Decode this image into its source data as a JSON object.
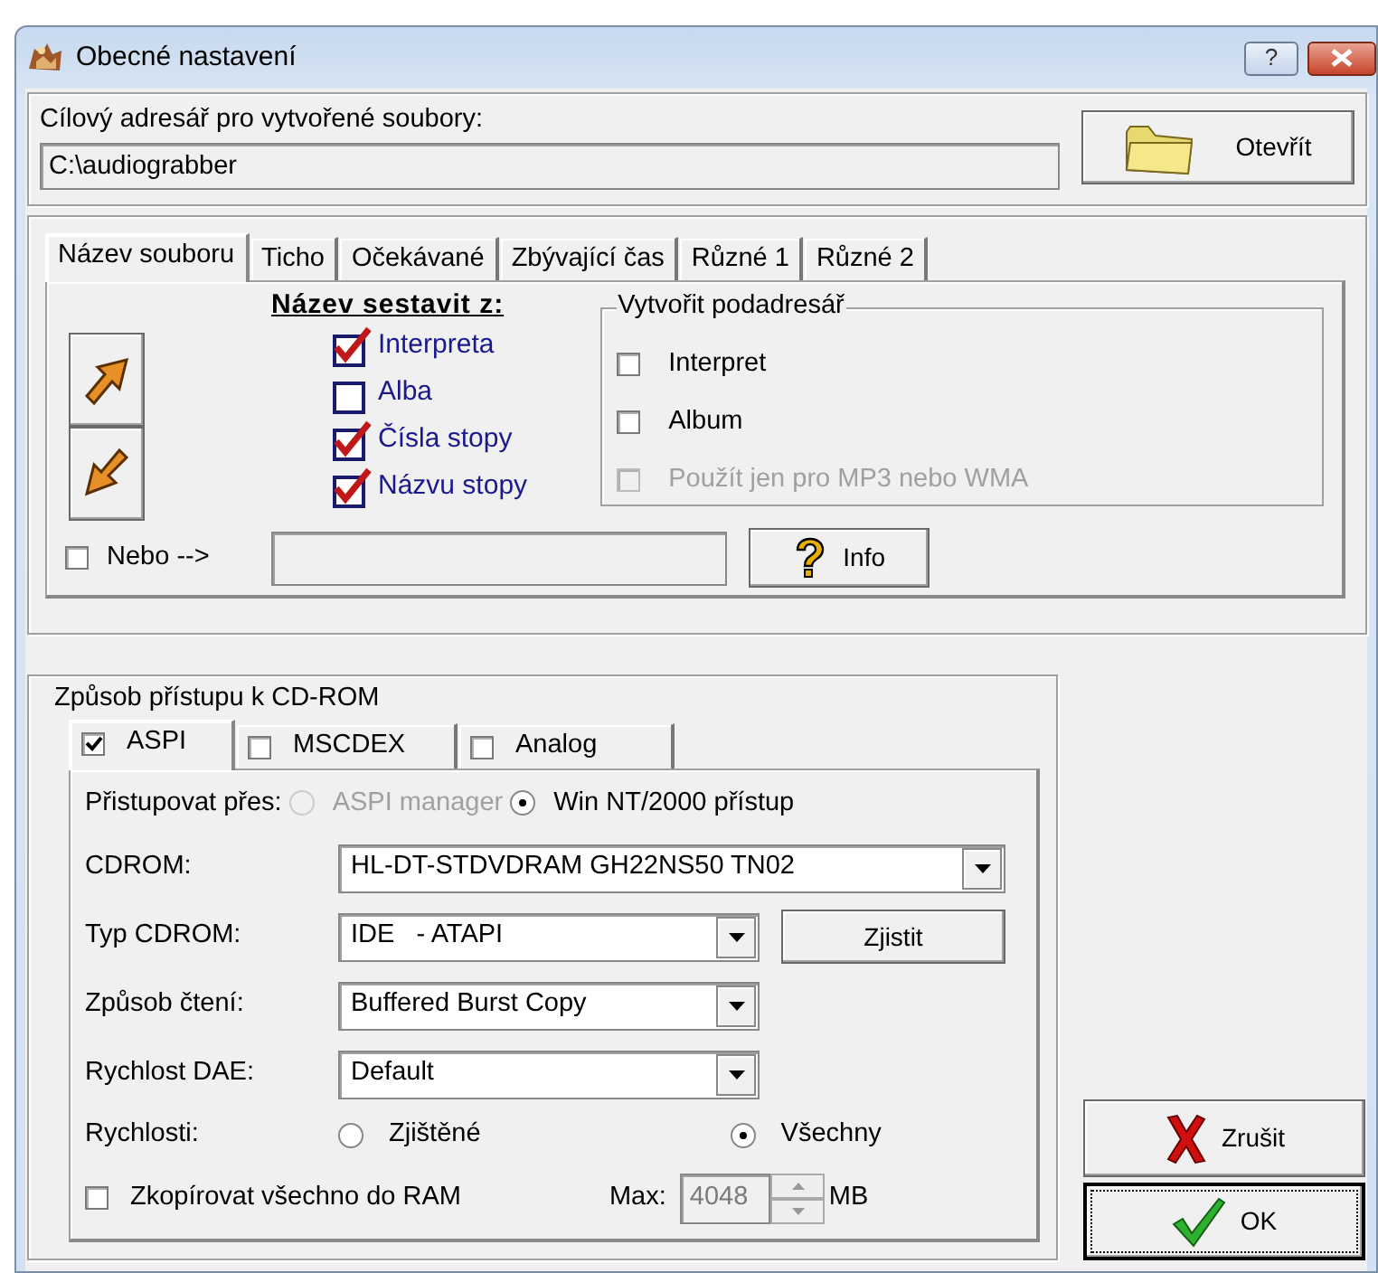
{
  "window": {
    "title": "Obecné nastavení",
    "help_button": "?"
  },
  "output_folder": {
    "label": "Cílový adresář pro vytvořené soubory:",
    "value": "C:\\audiograbber",
    "button": "Otevřít"
  },
  "filename_tabs": [
    {
      "label": "Název souboru",
      "selected": true
    },
    {
      "label": "Ticho",
      "selected": false
    },
    {
      "label": "Očekávané",
      "selected": false
    },
    {
      "label": "Zbývající čas",
      "selected": false
    },
    {
      "label": "Různé 1",
      "selected": false
    },
    {
      "label": "Různé 2",
      "selected": false
    }
  ],
  "name_from": {
    "title": "Název sestavit z:",
    "items": [
      {
        "label": "Interpreta",
        "checked": true
      },
      {
        "label": "Alba",
        "checked": false
      },
      {
        "label": "Čísla stopy",
        "checked": true
      },
      {
        "label": "Názvu stopy",
        "checked": true
      }
    ]
  },
  "subfolder": {
    "title": "Vytvořit podadresář",
    "items": [
      {
        "label": "Interpret",
        "checked": false,
        "disabled": false
      },
      {
        "label": "Album",
        "checked": false,
        "disabled": false
      },
      {
        "label": "Použít jen pro MP3 nebo WMA",
        "checked": false,
        "disabled": true
      }
    ]
  },
  "alternative": {
    "label": "Nebo -->",
    "checked": false
  },
  "info_button": "Info",
  "cdrom": {
    "title": "Způsob přístupu k CD-ROM",
    "tabs": [
      {
        "label": "ASPI",
        "checked": true,
        "selected": true
      },
      {
        "label": "MSCDEX",
        "checked": false,
        "selected": false
      },
      {
        "label": "Analog",
        "checked": false,
        "selected": false
      }
    ],
    "access": {
      "label": "Přistupovat přes:",
      "options": [
        {
          "label": "ASPI manager",
          "selected": false,
          "disabled": true
        },
        {
          "label": "Win NT/2000 přístup",
          "selected": true,
          "disabled": false
        }
      ]
    },
    "fields": [
      {
        "label": "CDROM:",
        "value": "HL-DT-STDVDRAM GH22NS50 TN02"
      },
      {
        "label": "Typ CDROM:",
        "value": "IDE   - ATAPI",
        "button": "Zjistit"
      },
      {
        "label": "Způsob čtení:",
        "value": "Buffered Burst Copy"
      },
      {
        "label": "Rychlost DAE:",
        "value": "Default"
      }
    ],
    "speeds": {
      "label": "Rychlosti:",
      "options": [
        {
          "label": "Zjištěné",
          "selected": false,
          "disabled": false
        },
        {
          "label": "Všechny",
          "selected": true,
          "disabled": false
        }
      ]
    },
    "copy_to_ram": {
      "label": "Zkopírovat všechno do RAM",
      "checked": false
    },
    "max": {
      "label": "Max:",
      "value": "4048",
      "unit": "MB",
      "disabled": true
    }
  },
  "buttons": [
    {
      "label": "Zrušit",
      "kind": "cancel",
      "default": false
    },
    {
      "label": "OK",
      "kind": "ok",
      "default": true
    }
  ]
}
